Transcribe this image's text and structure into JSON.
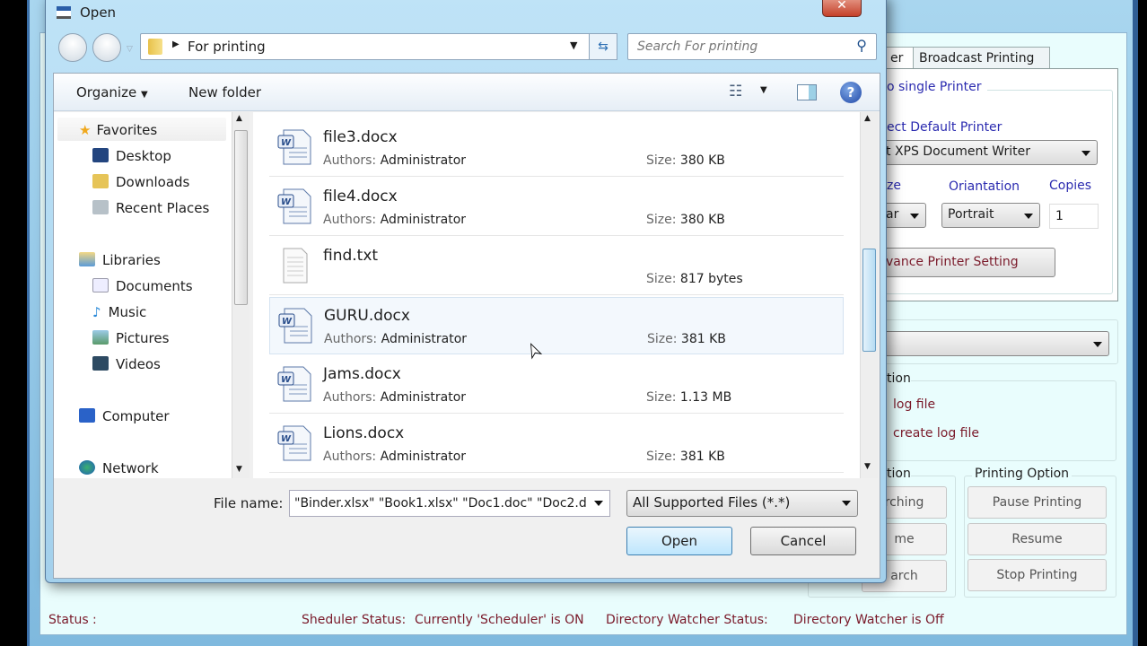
{
  "app": {
    "tabs": [
      {
        "label": "er"
      },
      {
        "label": "Broadcast Printing"
      }
    ],
    "group_title": "o single Printer",
    "default_printer_label": "ect Default Printer",
    "printer_value": "t XPS Document Writer",
    "size_label": "ze",
    "size_value": "ar",
    "orientation_label": "Oriantation",
    "orientation_value": "Portrait",
    "copies_label": "Copies",
    "copies_value": "1",
    "advance_button": "vance Printer Setting",
    "log_group_title": "tion",
    "log_option1": "log file",
    "log_option2": "create log file",
    "search_group_title": "tion",
    "search_buttons": [
      "rching",
      "me",
      "arch"
    ],
    "printing_group_title": "Printing Option",
    "printing_buttons": [
      "Pause Printing",
      "Resume",
      "Stop Printing"
    ],
    "status": {
      "label": "Status :",
      "scheduler_label": "Sheduler Status:",
      "scheduler_value": "Currently 'Scheduler' is ON",
      "watcher_label": "Directory Watcher Status:",
      "watcher_value": "Directory Watcher is Off"
    }
  },
  "dialog": {
    "title": "Open",
    "close": "x",
    "breadcrumb": "For printing",
    "search_placeholder": "Search For printing",
    "toolbar": {
      "organize": "Organize",
      "new_folder": "New folder"
    },
    "nav": {
      "favorites": "Favorites",
      "fav_items": [
        "Desktop",
        "Downloads",
        "Recent Places"
      ],
      "libraries": "Libraries",
      "lib_items": [
        "Documents",
        "Music",
        "Pictures",
        "Videos"
      ],
      "computer": "Computer",
      "network": "Network"
    },
    "files": [
      {
        "name": "file3.docx",
        "authors_label": "Authors:",
        "authors": "Administrator",
        "size_label": "Size:",
        "size": "380 KB",
        "type": "word"
      },
      {
        "name": "file4.docx",
        "authors_label": "Authors:",
        "authors": "Administrator",
        "size_label": "Size:",
        "size": "380 KB",
        "type": "word"
      },
      {
        "name": "find.txt",
        "authors_label": "",
        "authors": "",
        "size_label": "Size:",
        "size": "817 bytes",
        "type": "text"
      },
      {
        "name": "GURU.docx",
        "authors_label": "Authors:",
        "authors": "Administrator",
        "size_label": "Size:",
        "size": "381 KB",
        "type": "word",
        "hover": true
      },
      {
        "name": "Jams.docx",
        "authors_label": "Authors:",
        "authors": "Administrator",
        "size_label": "Size:",
        "size": "1.13 MB",
        "type": "word"
      },
      {
        "name": "Lions.docx",
        "authors_label": "Authors:",
        "authors": "Administrator",
        "size_label": "Size:",
        "size": "381 KB",
        "type": "word"
      }
    ],
    "filename_label": "File name:",
    "filename_value": "\"Binder.xlsx\" \"Book1.xlsx\" \"Doc1.doc\" \"Doc2.d",
    "filetype_value": "All Supported Files (*.*)",
    "open_button": "Open",
    "cancel_button": "Cancel"
  }
}
